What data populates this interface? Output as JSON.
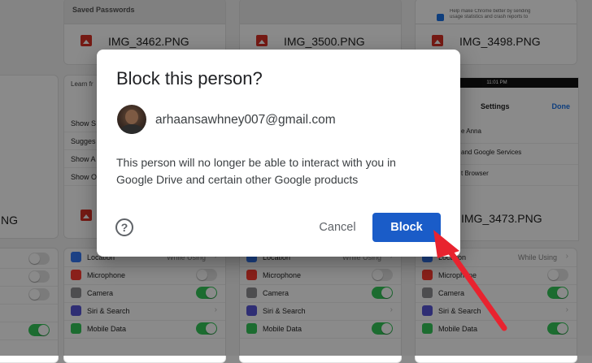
{
  "background": {
    "cards": [
      {
        "header": "Saved Passwords",
        "filename": "IMG_3462.PNG"
      },
      {
        "header": "",
        "filename": "IMG_3500.PNG"
      },
      {
        "header": "",
        "filename": "IMG_3498.PNG"
      },
      {
        "header": "",
        "filename": "IMG_3473.PNG"
      }
    ],
    "snippet_left": "Learn fr",
    "snippet_left_rows": [
      "Show S",
      "Sugges",
      "Show A",
      "Show O"
    ],
    "left_edge_filename": "NG",
    "chrome_checkbox_text": "Help make Chrome better by sending usage statistics and crash reports to",
    "phone": {
      "time": "11:01 PM",
      "battery": "43%",
      "title": "Settings",
      "done": "Done",
      "rows": [
        "e Anna",
        "and Google Services",
        "t Browser"
      ]
    },
    "settings_rows": [
      {
        "label": "Location",
        "value": "While Using",
        "type": "chevron",
        "color": "#3478f6"
      },
      {
        "label": "Microphone",
        "type": "toggle-off",
        "color": "#ff3b30"
      },
      {
        "label": "Camera",
        "type": "toggle-on",
        "color": "#8e8e93"
      },
      {
        "label": "Siri & Search",
        "type": "chevron",
        "color": "#5856d6"
      },
      {
        "label": "Mobile Data",
        "type": "toggle-on",
        "color": "#34c759"
      }
    ]
  },
  "dialog": {
    "title": "Block this person?",
    "email": "arhaansawhney007@gmail.com",
    "description": "This person will no longer be able to interact with you in Google Drive and certain other Google products",
    "help_icon": "help-circle-icon",
    "cancel_label": "Cancel",
    "block_label": "Block",
    "accent": "#1a5cc8"
  },
  "annotation": {
    "arrow_color": "#e8232f"
  }
}
